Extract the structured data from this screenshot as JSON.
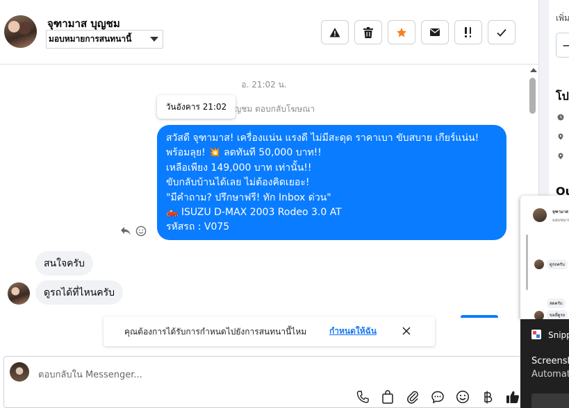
{
  "header": {
    "contact_name": "จุฑามาส บุญชม",
    "assign_dropdown": "มอบหมายการสนทนานี้",
    "actions": [
      "spam-report",
      "delete",
      "star",
      "mark-unread",
      "follow-up",
      "mark-done"
    ]
  },
  "chat": {
    "timestamp": "อ. 21:02 น.",
    "replied_note": "ญชม ตอบกลับโฆษณา",
    "tooltip": "วันอังคาร 21:02",
    "outgoing_message": [
      "สวัสดี จุฑามาส! เครื่องแน่น แรงดี ไม่มีสะดุด ราคาเบา ขับสบาย เกียร์แน่น!",
      "พร้อมลุย! 💥 ลดทันที 50,000 บาท!!",
      "เหลือเพียง 149,000 บาท เท่านั้น!!",
      "ขับกลับบ้านได้เลย ไม่ต้องคิดเยอะ!",
      "\"มีคำถาม? ปรึกษาฟรี! ทัก Inbox ด่วน\"",
      "🛻  ISUZU D-MAX 2003 Rodeo 3.0 AT",
      "รหัสรถ : V075"
    ],
    "incoming_1": "สนใจครับ",
    "incoming_2": "ดูรถได้ที่ไหนครับ"
  },
  "banner": {
    "text": "คุณต้องการได้รับการกำหนดไปยังการสนทนานี้ไหม",
    "link": "กำหนดให้ฉัน"
  },
  "composer": {
    "placeholder": "ตอบกลับใน Messenger...",
    "tools": [
      "phone",
      "shopping-bag",
      "attachment",
      "saved-replies",
      "emoji",
      "baht",
      "like"
    ]
  },
  "right_panel": {
    "add_label": "เพิ่ม",
    "heading": "โป",
    "heading2": "Ou"
  },
  "thumbnail": {
    "name": "จุฑามาส",
    "sub": "มอบหมาย",
    "msg1": "ดูรถครับ",
    "msg2": "สดครับ",
    "msg3": "ขอที่ดูรถ"
  },
  "toast": {
    "app_name": "Snipp",
    "title": "Screensh",
    "subtitle": "Automat"
  },
  "colors": {
    "accent_blue": "#0a7cff",
    "link_blue": "#1877f2",
    "star_orange": "#f5821f",
    "bubble_grey": "#f0f2f5"
  }
}
